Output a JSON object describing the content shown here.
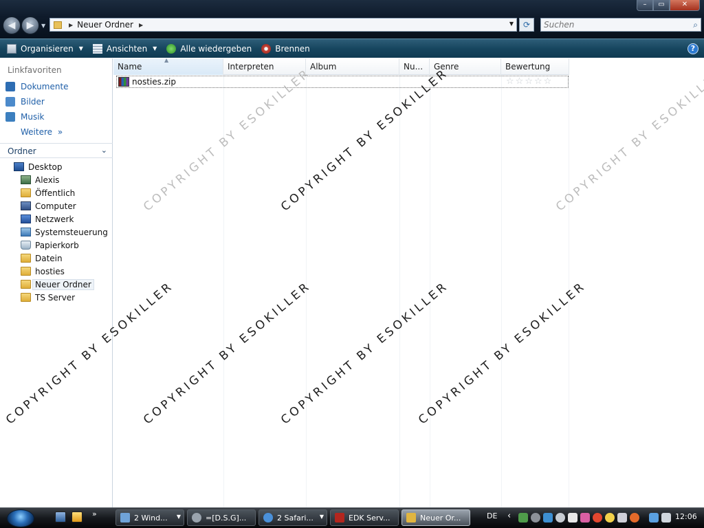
{
  "window": {
    "controls": {
      "minimize": "–",
      "maximize": "▭",
      "close": "✕"
    }
  },
  "nav": {
    "back": "◀",
    "forward": "▶"
  },
  "address": {
    "crumb": "Neuer Ordner",
    "separator": "▶"
  },
  "search": {
    "placeholder": "Suchen"
  },
  "commandbar": {
    "organize": "Organisieren",
    "views": "Ansichten",
    "play_all": "Alle wiedergeben",
    "burn": "Brennen",
    "help": "?"
  },
  "navpane": {
    "favorites_header": "Linkfavoriten",
    "favorites": [
      {
        "label": "Dokumente",
        "icon": "documents-icon",
        "color": "#2e6db3"
      },
      {
        "label": "Bilder",
        "icon": "pictures-icon",
        "color": "#4c8acb"
      },
      {
        "label": "Musik",
        "icon": "music-icon",
        "color": "#3c7fbf"
      }
    ],
    "more": "Weitere",
    "more_arrows": "»",
    "folders_header": "Ordner",
    "tree": [
      {
        "label": "Desktop",
        "icon": "desktop-icon",
        "level": 0
      },
      {
        "label": "Alexis",
        "icon": "user-folder-icon",
        "level": 1
      },
      {
        "label": "Öffentlich",
        "icon": "folder-icon",
        "level": 1
      },
      {
        "label": "Computer",
        "icon": "computer-icon",
        "level": 1
      },
      {
        "label": "Netzwerk",
        "icon": "network-icon",
        "level": 1
      },
      {
        "label": "Systemsteuerung",
        "icon": "control-panel-icon",
        "level": 1
      },
      {
        "label": "Papierkorb",
        "icon": "recycle-bin-icon",
        "level": 1
      },
      {
        "label": "Datein",
        "icon": "folder-icon",
        "level": 1
      },
      {
        "label": "hosties",
        "icon": "folder-icon",
        "level": 1
      },
      {
        "label": "Neuer Ordner",
        "icon": "folder-icon",
        "level": 1,
        "selected": true
      },
      {
        "label": "TS Server",
        "icon": "folder-icon",
        "level": 1
      }
    ]
  },
  "filelist": {
    "columns": [
      "Name",
      "Interpreten",
      "Album",
      "Nu...",
      "Genre",
      "Bewertung"
    ],
    "sort_column": "Name",
    "files": [
      {
        "name": "nosties.zip",
        "icon": "winrar-archive-icon",
        "rating": 0,
        "rating_max": 5
      }
    ]
  },
  "watermark": {
    "text": "COPYRIGHT BY ESOKILLER"
  },
  "taskbar": {
    "buttons": [
      {
        "label": "2 Wind...",
        "icon": "windows-explorer-icon",
        "color": "#6fa3d8",
        "dropdown": true
      },
      {
        "label": "=[D.S.G]...",
        "icon": "steam-icon",
        "color": "#9aa3ad",
        "dropdown": false
      },
      {
        "label": "2 Safari...",
        "icon": "safari-icon",
        "color": "#4a90d9",
        "dropdown": true
      },
      {
        "label": "EDK Serv...",
        "icon": "filezilla-icon",
        "color": "#b3261e",
        "dropdown": false
      },
      {
        "label": "Neuer Or...",
        "icon": "folder-icon",
        "color": "#e0b540",
        "dropdown": false,
        "active": true
      }
    ],
    "language": "DE",
    "tray_expand": "‹",
    "clock": "12:06"
  }
}
